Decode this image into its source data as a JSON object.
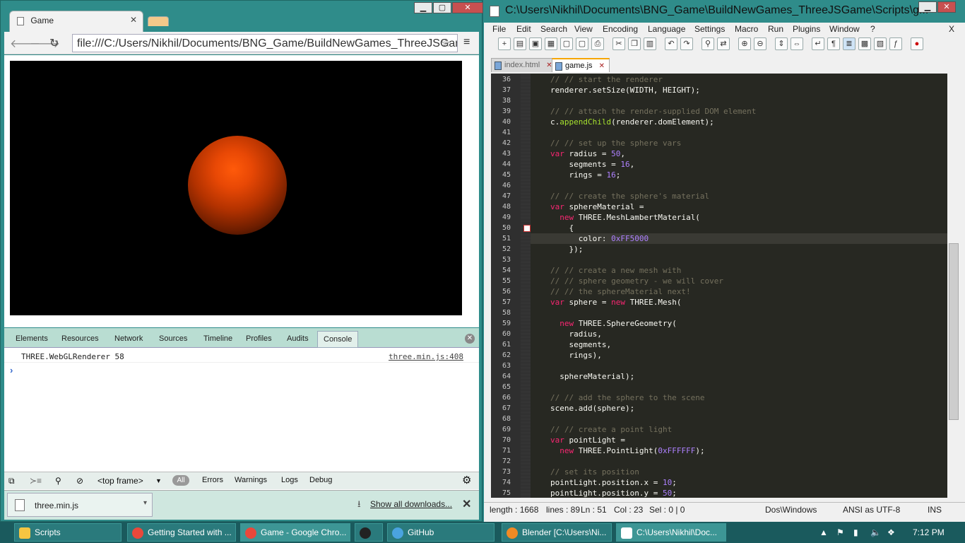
{
  "chrome": {
    "tab_title": "Game",
    "url": "file:///C:/Users/Nikhil/Documents/BNG_Game/BuildNewGames_ThreeJSGame",
    "devtools": {
      "tabs": [
        "Elements",
        "Resources",
        "Network",
        "Sources",
        "Timeline",
        "Profiles",
        "Audits",
        "Console"
      ],
      "active_tab": "Console",
      "console_message": "THREE.WebGLRenderer 58",
      "console_source": "three.min.js:408",
      "prompt": "›",
      "bottom": {
        "frame": "<top frame>",
        "all": "All",
        "errors": "Errors",
        "warnings": "Warnings",
        "logs": "Logs",
        "debug": "Debug"
      }
    },
    "download": {
      "file": "three.min.js",
      "show_all": "Show all downloads..."
    }
  },
  "npp": {
    "title": "C:\\Users\\Nikhil\\Documents\\BNG_Game\\BuildNewGames_ThreeJSGame\\Scripts\\g...",
    "menu": [
      "File",
      "Edit",
      "Search",
      "View",
      "Encoding",
      "Language",
      "Settings",
      "Macro",
      "Run",
      "Plugins",
      "Window",
      "?"
    ],
    "tabs": [
      {
        "label": "index.html",
        "active": false
      },
      {
        "label": "game.js",
        "active": true
      }
    ],
    "code": [
      {
        "n": "36",
        "t": "// // start the renderer",
        "k": "cm"
      },
      {
        "n": "37",
        "t": "renderer.setSize(WIDTH, HEIGHT);",
        "k": ""
      },
      {
        "n": "38",
        "t": "",
        "k": ""
      },
      {
        "n": "39",
        "t": "// // attach the render-supplied DOM element",
        "k": "cm"
      },
      {
        "n": "40",
        "t": "c.appendChild(renderer.domElement);",
        "k": ""
      },
      {
        "n": "41",
        "t": "",
        "k": ""
      },
      {
        "n": "42",
        "t": "// // set up the sphere vars",
        "k": "cm"
      },
      {
        "n": "43",
        "t": "var radius = 50,",
        "k": ""
      },
      {
        "n": "44",
        "t": "    segments = 16,",
        "k": ""
      },
      {
        "n": "45",
        "t": "    rings = 16;",
        "k": ""
      },
      {
        "n": "46",
        "t": "",
        "k": ""
      },
      {
        "n": "47",
        "t": "// // create the sphere's material",
        "k": "cm"
      },
      {
        "n": "48",
        "t": "var sphereMaterial =",
        "k": ""
      },
      {
        "n": "49",
        "t": "  new THREE.MeshLambertMaterial(",
        "k": ""
      },
      {
        "n": "50",
        "t": "    {",
        "k": ""
      },
      {
        "n": "51",
        "t": "      color: 0xFF5000",
        "k": ""
      },
      {
        "n": "52",
        "t": "    });",
        "k": ""
      },
      {
        "n": "53",
        "t": "",
        "k": ""
      },
      {
        "n": "54",
        "t": "// // create a new mesh with",
        "k": "cm"
      },
      {
        "n": "55",
        "t": "// // sphere geometry - we will cover",
        "k": "cm"
      },
      {
        "n": "56",
        "t": "// // the sphereMaterial next!",
        "k": "cm"
      },
      {
        "n": "57",
        "t": "var sphere = new THREE.Mesh(",
        "k": ""
      },
      {
        "n": "58",
        "t": "",
        "k": ""
      },
      {
        "n": "59",
        "t": "  new THREE.SphereGeometry(",
        "k": ""
      },
      {
        "n": "60",
        "t": "    radius,",
        "k": ""
      },
      {
        "n": "61",
        "t": "    segments,",
        "k": ""
      },
      {
        "n": "62",
        "t": "    rings),",
        "k": ""
      },
      {
        "n": "63",
        "t": "",
        "k": ""
      },
      {
        "n": "64",
        "t": "  sphereMaterial);",
        "k": ""
      },
      {
        "n": "65",
        "t": "",
        "k": ""
      },
      {
        "n": "66",
        "t": "// // add the sphere to the scene",
        "k": "cm"
      },
      {
        "n": "67",
        "t": "scene.add(sphere);",
        "k": ""
      },
      {
        "n": "68",
        "t": "",
        "k": ""
      },
      {
        "n": "69",
        "t": "// // create a point light",
        "k": "cm"
      },
      {
        "n": "70",
        "t": "var pointLight =",
        "k": ""
      },
      {
        "n": "71",
        "t": "  new THREE.PointLight(0xFFFFFF);",
        "k": ""
      },
      {
        "n": "72",
        "t": "",
        "k": ""
      },
      {
        "n": "73",
        "t": "// set its position",
        "k": "cm"
      },
      {
        "n": "74",
        "t": "pointLight.position.x = 10;",
        "k": ""
      },
      {
        "n": "75",
        "t": "pointLight.position.y = 50;",
        "k": ""
      }
    ],
    "status": {
      "length": "length : 1668",
      "lines": "lines : 89",
      "ln": "Ln : 51",
      "col": "Col : 23",
      "sel": "Sel : 0 | 0",
      "eol": "Dos\\Windows",
      "encoding": "ANSI as UTF-8",
      "mode": "INS"
    }
  },
  "taskbar": {
    "items": [
      "Scripts",
      "Getting Started with ...",
      "Game - Google Chro...",
      "",
      "GitHub",
      "Blender [C:\\Users\\Ni...",
      "C:\\Users\\Nikhil\\Doc..."
    ],
    "time": "7:12 PM"
  },
  "colors": {
    "sphere": "#FF5000",
    "editor_bg": "#272822",
    "accent": "#2f8c8a"
  }
}
